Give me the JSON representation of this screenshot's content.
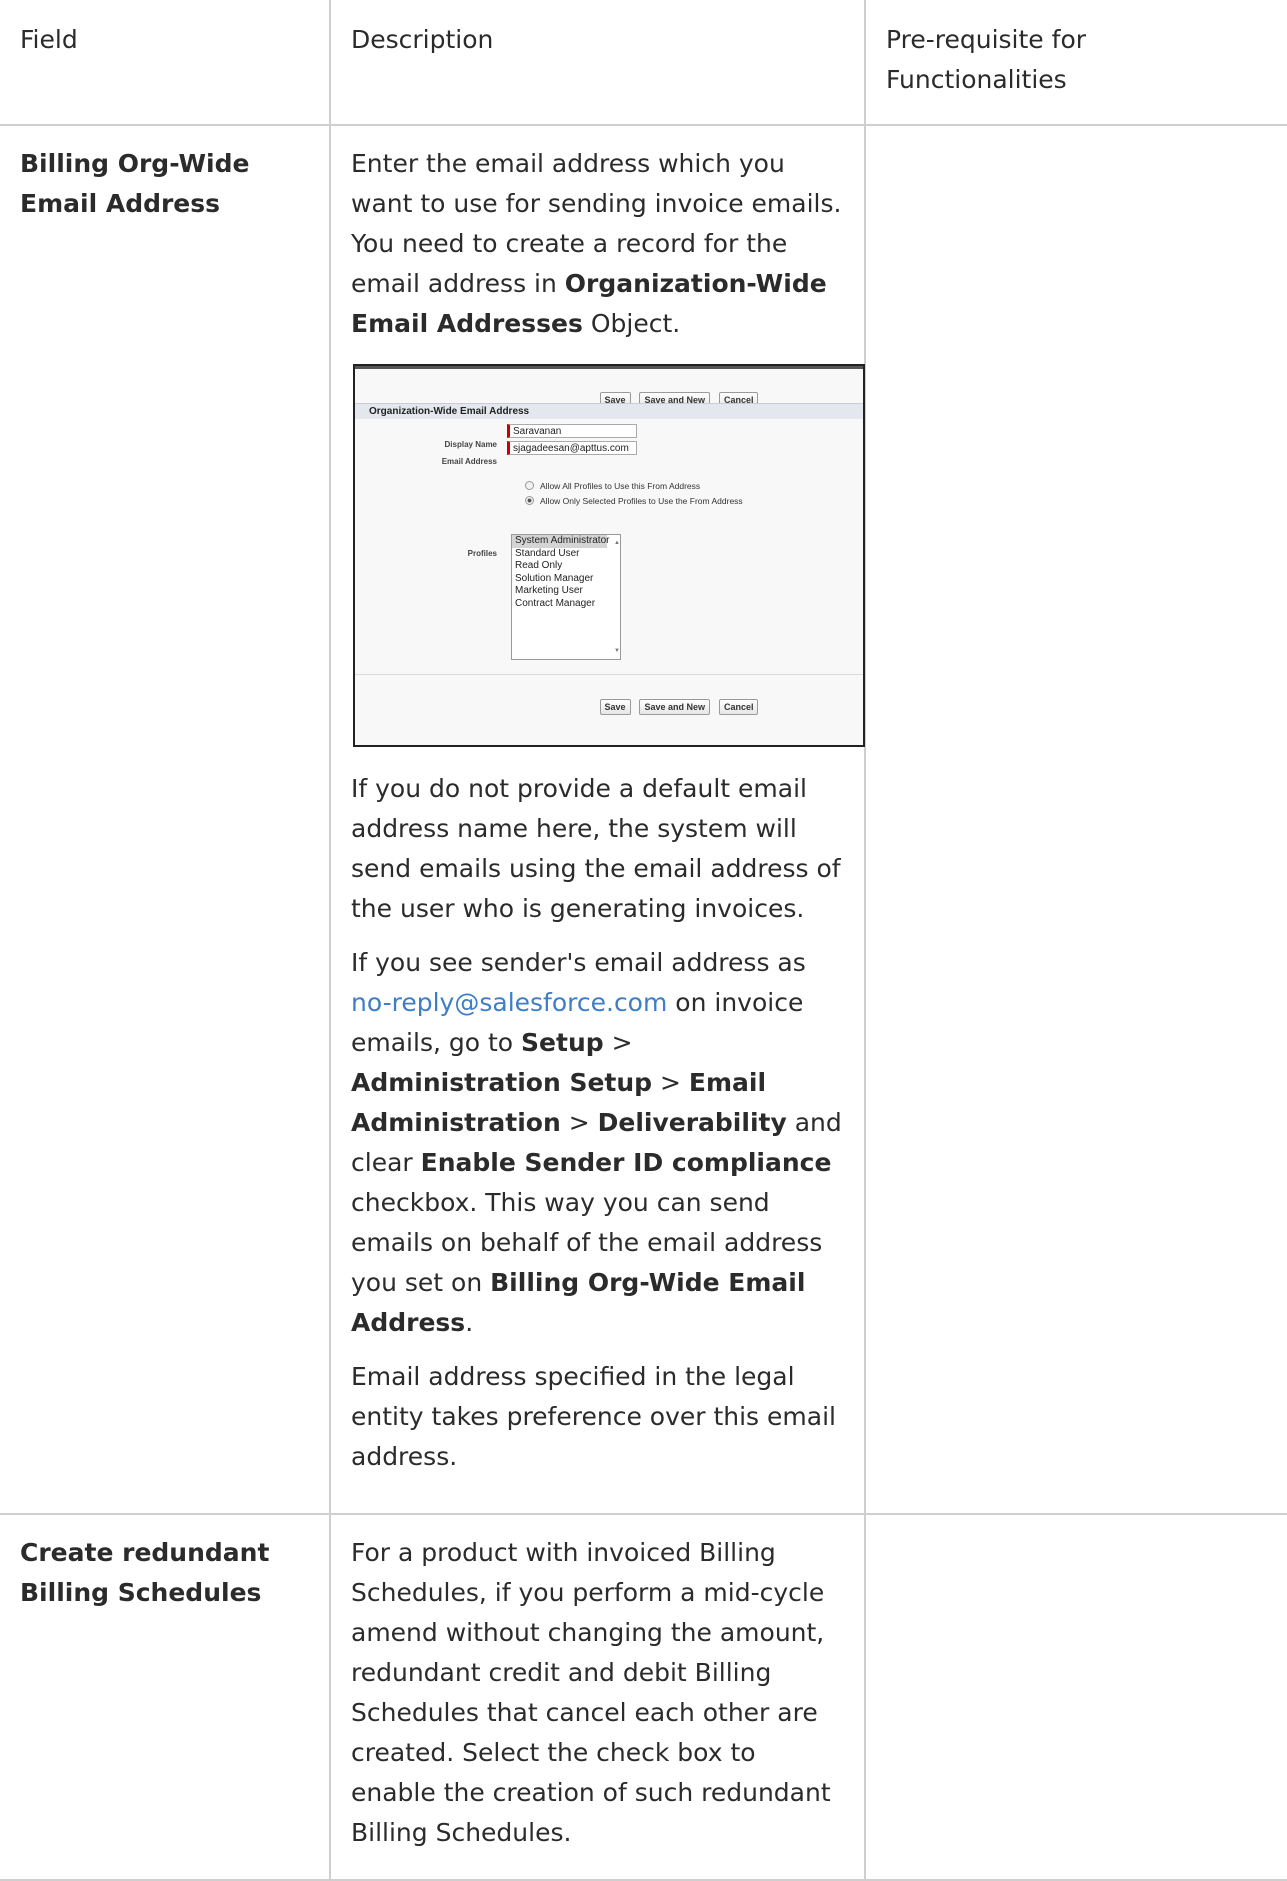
{
  "table": {
    "headers": [
      "Field",
      "Description",
      "Pre-requisite for Functionalities"
    ]
  },
  "row1": {
    "field": "Billing Org-Wide Email Address",
    "p1_a": "Enter the email address which you want to use for sending invoice emails. You need to create a record for the email address in ",
    "p1_b": "Organization-Wide Email Addresses",
    "p1_c": " Object.",
    "p2": "If you do not provide a default email address name here, the system will send emails using the email address of the user who is generating invoices.",
    "p3_a": "If you see sender's email address as ",
    "p3_link": "no-reply@salesforce.com",
    "p3_b": " on invoice emails, go to ",
    "p3_setup": "Setup",
    "p3_gt1": " > ",
    "p3_admin": "Administration Setup",
    "p3_gt2": " > ",
    "p3_emailadmin": "Email Administration",
    "p3_gt3": " > ",
    "p3_deliv": "Deliverability",
    "p3_c": " and clear ",
    "p3_sender": "Enable Sender ID compliance",
    "p3_d": " checkbox. This way you can send emails on behalf of the email address you set on ",
    "p3_billing": "Billing Org-Wide Email Address",
    "p3_e": ".",
    "p4": "Email address specified in the legal entity takes preference over this email address.",
    "prereq": ""
  },
  "screenshot": {
    "buttons": [
      "Save",
      "Save and New",
      "Cancel"
    ],
    "section_title": "Organization-Wide Email Address",
    "display_name_label": "Display Name",
    "display_name_value": "Saravanan",
    "email_label": "Email Address",
    "email_value": "sjagadeesan@apttus.com",
    "radio_all": "Allow All Profiles to Use this From Address",
    "radio_selected": "Allow Only Selected Profiles to Use the From Address",
    "profiles_label": "Profiles",
    "profiles": [
      "System Administrator",
      "Standard User",
      "Read Only",
      "Solution Manager",
      "Marketing User",
      "Contract Manager"
    ]
  },
  "row2": {
    "field": "Create redundant Billing Schedules",
    "description": "For a product with invoiced Billing Schedules, if you perform a mid-cycle amend without changing the amount, redundant credit and debit Billing Schedules that cancel each other are created. Select the check box to enable the creation of such redundant Billing Schedules.",
    "prereq": ""
  }
}
